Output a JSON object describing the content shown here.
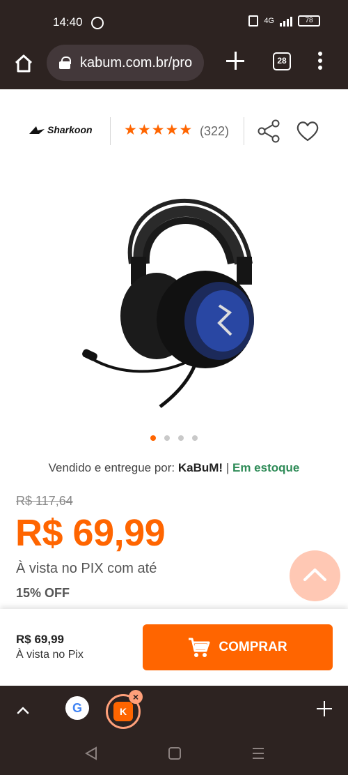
{
  "status_bar": {
    "time": "14:40",
    "network": "4G",
    "battery": "78"
  },
  "browser": {
    "url": "kabum.com.br/pro",
    "tabs_count": "28"
  },
  "product": {
    "brand": "Sharkoon",
    "rating_stars": 5,
    "review_count": "(322)",
    "carousel": {
      "total": 4,
      "active": 1
    },
    "seller_prefix": "Vendido e entregue por:",
    "seller_name": "KaBuM!",
    "seller_sep": "|",
    "stock_status": "Em estoque",
    "old_price": "R$ 117,64",
    "price": "R$ 69,99",
    "pix_text": "À vista no PIX com até",
    "discount": "15% OFF"
  },
  "buy_bar": {
    "price": "R$ 69,99",
    "subtitle": "À vista no Pix",
    "button_label": "COMPRAR"
  },
  "tab_strip": {
    "google_label": "G",
    "kabum_label": "K"
  },
  "colors": {
    "accent": "#ff6500",
    "stock_green": "#2e8b57",
    "chrome_dark": "#2d2321"
  }
}
